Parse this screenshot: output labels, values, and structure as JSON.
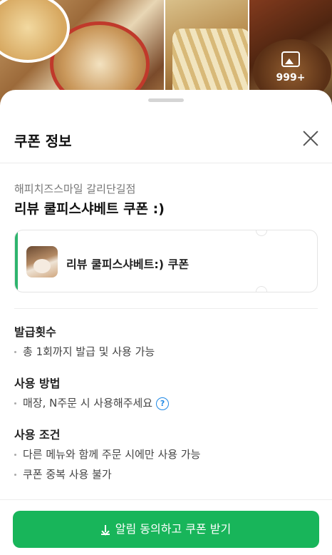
{
  "gallery": {
    "more_count": "999+"
  },
  "sheet": {
    "title": "쿠폰 정보",
    "store_name": "해피치즈스마일 갈리단길점",
    "coupon_title": "리뷰 쿨피스샤베트 쿠폰 :)",
    "ticket_label": "리뷰 쿨피스샤베트:) 쿠폰",
    "sections": {
      "issue": {
        "title": "발급횟수",
        "items": [
          "총 1회까지 발급 및 사용 가능"
        ]
      },
      "usage": {
        "title": "사용 방법",
        "items": [
          "매장, N주문 시 사용해주세요"
        ]
      },
      "conditions": {
        "title": "사용 조건",
        "items": [
          "다른 메뉴와 함께 주문 시에만 사용 가능",
          "쿠폰 중복 사용 불가"
        ]
      }
    },
    "cta_label": "알림 동의하고 쿠폰 받기"
  },
  "colors": {
    "accent": "#18b55a",
    "ticket_bar": "#2db46d",
    "help_icon": "#1e88e5"
  }
}
